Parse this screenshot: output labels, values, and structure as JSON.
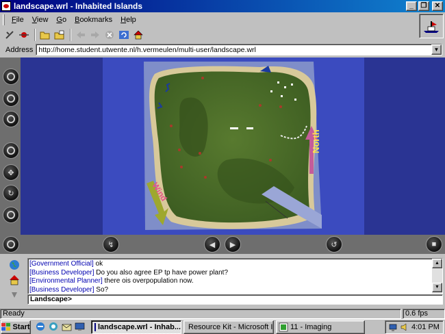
{
  "window": {
    "title": "landscape.wrl - Inhabited Islands"
  },
  "menu": {
    "items": [
      "File",
      "View",
      "Go",
      "Bookmarks",
      "Help"
    ]
  },
  "address": {
    "label": "Address",
    "url": "http://home.student.utwente.nl/h.vermeulen/multi-user/landscape.wrl"
  },
  "scene": {
    "north_label": "North",
    "wind_label": "Wind"
  },
  "chat": {
    "messages": [
      {
        "who": "[Government Official]",
        "text": "ok"
      },
      {
        "who": "[Business Developer]",
        "text": "Do you also agree EP tp have power plant?"
      },
      {
        "who": "[Environmental Planner]",
        "text": "there ois overpopulation now."
      },
      {
        "who": "[Business Developer]",
        "text": "So?"
      }
    ],
    "input_prompt": "Landscape>"
  },
  "status": {
    "text": "Ready",
    "fps": "0.6 fps"
  },
  "taskbar": {
    "start_label": "Start",
    "tasks": [
      "landscape.wrl - Inhab...",
      "Resource Kit - Microsoft In...",
      "11 - Imaging"
    ],
    "clock": "4:01 PM"
  }
}
